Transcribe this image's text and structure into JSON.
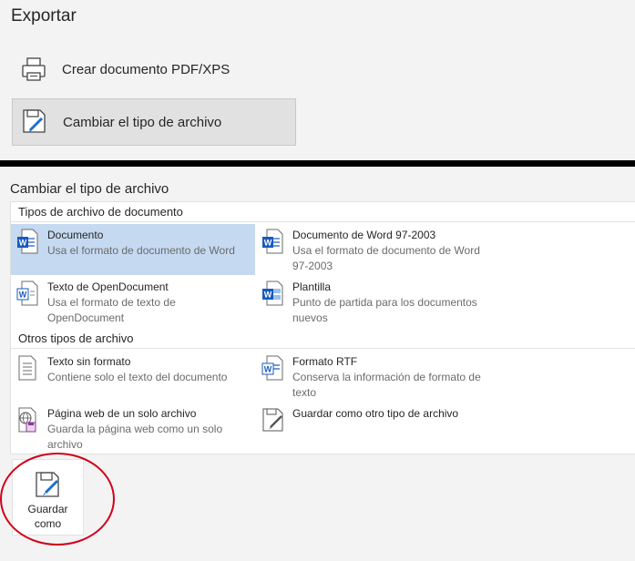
{
  "page": {
    "title": "Exportar"
  },
  "export_options": [
    {
      "label": "Crear documento PDF/XPS",
      "icon": "printer-pdf-icon",
      "selected": false
    },
    {
      "label": "Cambiar el tipo de archivo",
      "icon": "change-file-type-icon",
      "selected": true
    }
  ],
  "change_type": {
    "title": "Cambiar el tipo de archivo",
    "groups": [
      {
        "header": "Tipos de archivo de documento",
        "items": [
          {
            "name": "Documento",
            "desc": "Usa el formato de documento de Word",
            "icon": "word-document-icon",
            "selected": true
          },
          {
            "name": "Documento de Word 97-2003",
            "desc": "Usa el formato de documento de Word 97-2003",
            "icon": "word-97-2003-icon",
            "selected": false
          },
          {
            "name": "Texto de OpenDocument",
            "desc": "Usa el formato de texto de OpenDocument",
            "icon": "opendocument-text-icon",
            "selected": false
          },
          {
            "name": "Plantilla",
            "desc": "Punto de partida para los documentos nuevos",
            "icon": "word-template-icon",
            "selected": false
          }
        ]
      },
      {
        "header": "Otros tipos de archivo",
        "items": [
          {
            "name": "Texto sin formato",
            "desc": "Contiene solo el texto del documento",
            "icon": "plain-text-icon",
            "selected": false
          },
          {
            "name": "Formato RTF",
            "desc": "Conserva la información de formato de texto",
            "icon": "rtf-icon",
            "selected": false
          },
          {
            "name": "Página web de un solo archivo",
            "desc": "Guarda la página web como un solo archivo",
            "icon": "single-file-webpage-icon",
            "selected": false
          },
          {
            "name": "Guardar como otro tipo de archivo",
            "desc": "",
            "icon": "save-as-other-icon",
            "selected": false
          }
        ]
      }
    ]
  },
  "save_as_button": {
    "label": "Guardar como",
    "icon": "save-as-icon"
  },
  "colors": {
    "selected_bg": "#c5d9f1",
    "word_blue": "#185abd",
    "annotation_red": "#d0021b"
  }
}
